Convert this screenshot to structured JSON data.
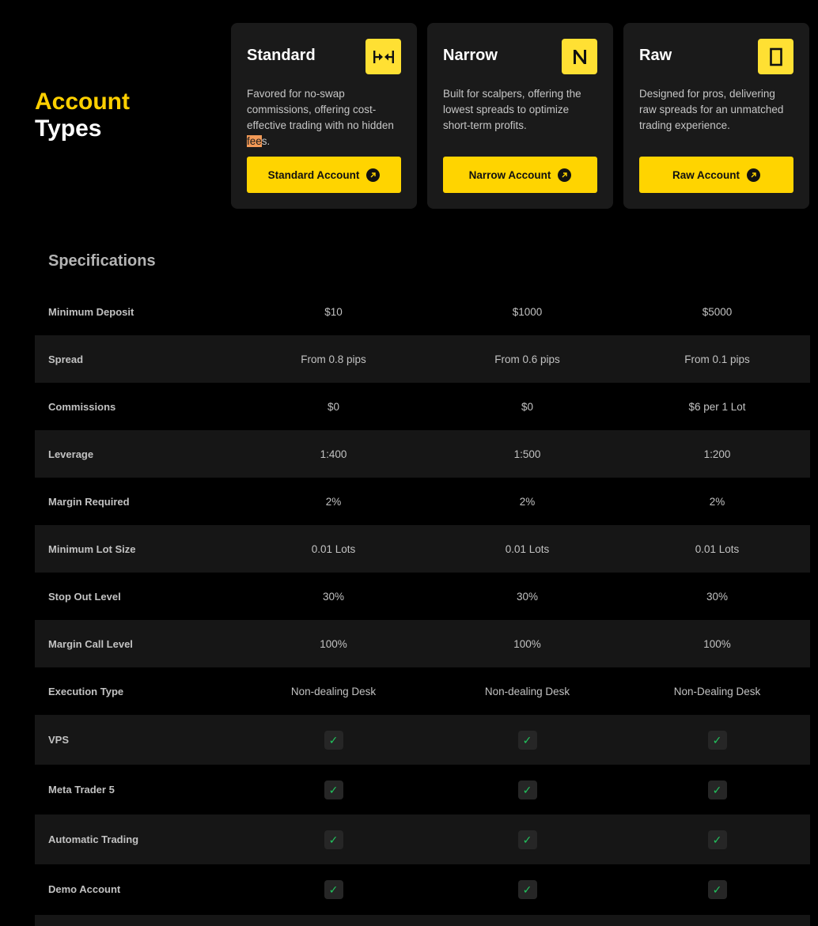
{
  "heading": {
    "accent": "Account",
    "main": "Types"
  },
  "cards": [
    {
      "title": "Standard",
      "icon": "arrows-inward-icon",
      "desc_before": "Favored for no-swap commissions, offering cost-effective trading with no hidden ",
      "desc_highlight": "fee",
      "desc_after": "s.",
      "button": "Standard Account"
    },
    {
      "title": "Narrow",
      "icon": "letter-n-icon",
      "description": "Built for scalpers, offering the lowest spreads to optimize short-term profits.",
      "button": "Narrow Account"
    },
    {
      "title": "Raw",
      "icon": "rectangle-icon",
      "description": "Designed for pros, delivering raw spreads for an unmatched trading experience.",
      "button": "Raw Account"
    }
  ],
  "specifications": {
    "title": "Specifications",
    "rows": [
      {
        "label": "Minimum Deposit",
        "values": [
          "$10",
          "$1000",
          "$5000"
        ]
      },
      {
        "label": "Spread",
        "values": [
          "From 0.8 pips",
          "From 0.6 pips",
          "From 0.1 pips"
        ]
      },
      {
        "label": "Commissions",
        "values": [
          "$0",
          "$0",
          "$6 per 1 Lot"
        ]
      },
      {
        "label": "Leverage",
        "values": [
          "1:400",
          "1:500",
          "1:200"
        ]
      },
      {
        "label": "Margin Required",
        "values": [
          "2%",
          "2%",
          "2%"
        ]
      },
      {
        "label": "Minimum Lot Size",
        "values": [
          "0.01 Lots",
          "0.01 Lots",
          "0.01 Lots"
        ]
      },
      {
        "label": "Stop Out Level",
        "values": [
          "30%",
          "30%",
          "30%"
        ]
      },
      {
        "label": "Margin Call Level",
        "values": [
          "100%",
          "100%",
          "100%"
        ]
      },
      {
        "label": "Execution Type",
        "values": [
          "Non-dealing Desk",
          "Non-dealing Desk",
          "Non-Dealing Desk"
        ]
      },
      {
        "label": "VPS",
        "values": [
          "✓",
          "✓",
          "✓"
        ]
      },
      {
        "label": "Meta Trader 5",
        "values": [
          "✓",
          "✓",
          "✓"
        ]
      },
      {
        "label": "Automatic Trading",
        "values": [
          "✓",
          "✓",
          "✓"
        ]
      },
      {
        "label": "Demo Account",
        "values": [
          "✓",
          "✓",
          "✓"
        ]
      }
    ]
  },
  "colors": {
    "accent": "#ffd400",
    "card_bg": "#1a1a1a",
    "check": "#22c55e"
  }
}
